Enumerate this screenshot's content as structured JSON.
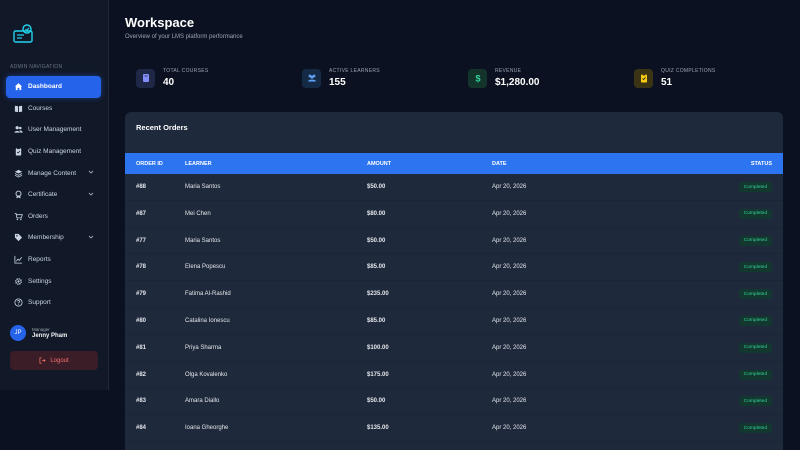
{
  "sidebar": {
    "heading": "ADMIN NAVIGATION",
    "items": [
      {
        "label": "Dashboard",
        "icon": "home-icon",
        "active": true
      },
      {
        "label": "Courses",
        "icon": "book-icon"
      },
      {
        "label": "User Management",
        "icon": "users-icon"
      },
      {
        "label": "Quiz Management",
        "icon": "clipboard-icon"
      },
      {
        "label": "Manage Content",
        "icon": "layers-icon",
        "has_submenu": true
      },
      {
        "label": "Certificate",
        "icon": "award-icon",
        "has_submenu": true
      },
      {
        "label": "Orders",
        "icon": "cart-icon"
      },
      {
        "label": "Membership",
        "icon": "tag-icon",
        "has_submenu": true
      },
      {
        "label": "Reports",
        "icon": "chart-icon"
      },
      {
        "label": "Settings",
        "icon": "gear-icon"
      },
      {
        "label": "Support",
        "icon": "help-icon"
      }
    ],
    "user": {
      "initials": "JP",
      "role": "Manager",
      "name": "Jenny Pham"
    },
    "logout_label": "Logout"
  },
  "header": {
    "title": "Workspace",
    "subtitle": "Overview of your LMS platform performance"
  },
  "stats": [
    {
      "label": "TOTAL COURSES",
      "value": "40",
      "icon": "book-icon",
      "color": "#818cf8"
    },
    {
      "label": "ACTIVE LEARNERS",
      "value": "155",
      "icon": "users-icon",
      "color": "#60a5fa"
    },
    {
      "label": "REVENUE",
      "value": "$1,280.00",
      "icon": "dollar-icon",
      "color": "#34d399"
    },
    {
      "label": "QUIZ COMPLETIONS",
      "value": "51",
      "icon": "clipboard-check-icon",
      "color": "#facc15"
    }
  ],
  "orders": {
    "title": "Recent Orders",
    "columns": [
      "ORDER ID",
      "LEARNER",
      "AMOUNT",
      "DATE",
      "STATUS"
    ],
    "rows": [
      {
        "id": "#88",
        "learner": "Maria Santos",
        "amount": "$50.00",
        "date": "Apr 20, 2026",
        "status": "Completed"
      },
      {
        "id": "#87",
        "learner": "Mei Chen",
        "amount": "$80.00",
        "date": "Apr 20, 2026",
        "status": "Completed"
      },
      {
        "id": "#77",
        "learner": "Maria Santos",
        "amount": "$50.00",
        "date": "Apr 20, 2026",
        "status": "Completed"
      },
      {
        "id": "#78",
        "learner": "Elena Popescu",
        "amount": "$85.00",
        "date": "Apr 20, 2026",
        "status": "Completed"
      },
      {
        "id": "#79",
        "learner": "Fatima Al-Rashid",
        "amount": "$235.00",
        "date": "Apr 20, 2026",
        "status": "Completed"
      },
      {
        "id": "#80",
        "learner": "Catalina Ionescu",
        "amount": "$85.00",
        "date": "Apr 20, 2026",
        "status": "Completed"
      },
      {
        "id": "#81",
        "learner": "Priya Sharma",
        "amount": "$100.00",
        "date": "Apr 20, 2026",
        "status": "Completed"
      },
      {
        "id": "#82",
        "learner": "Olga Kovalenko",
        "amount": "$175.00",
        "date": "Apr 20, 2026",
        "status": "Completed"
      },
      {
        "id": "#83",
        "learner": "Amara Diallo",
        "amount": "$50.00",
        "date": "Apr 20, 2026",
        "status": "Completed"
      },
      {
        "id": "#84",
        "learner": "Ioana Gheorghe",
        "amount": "$135.00",
        "date": "Apr 20, 2026",
        "status": "Completed"
      }
    ]
  },
  "colors": {
    "accent": "#2563eb",
    "background": "#0b1120",
    "panel": "#1e293b",
    "status_completed": "#34d399",
    "logout": "#f87171"
  }
}
